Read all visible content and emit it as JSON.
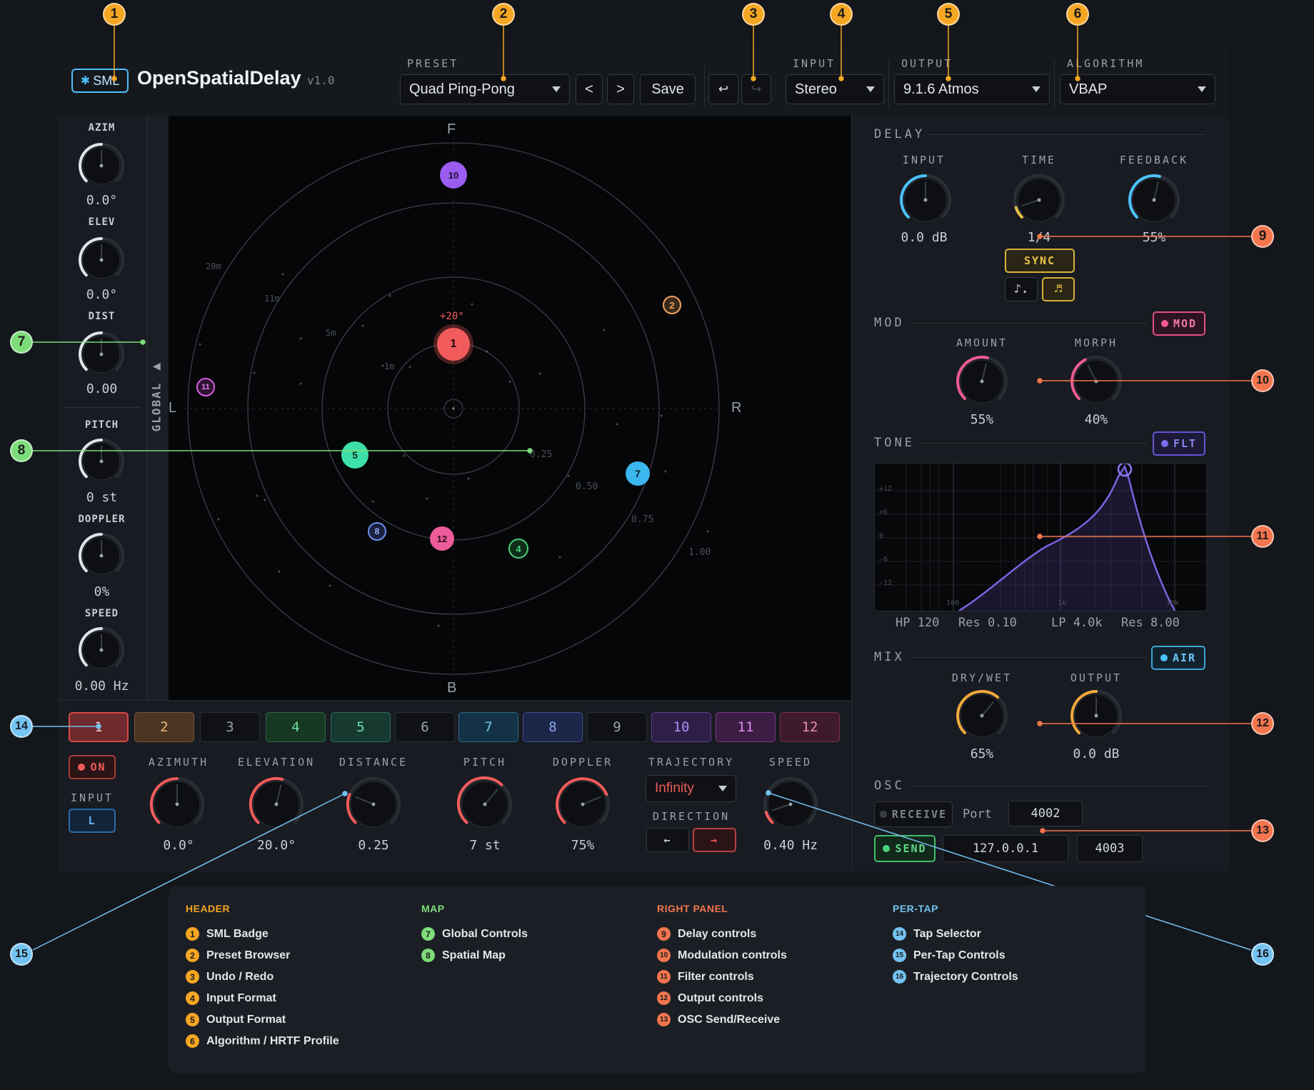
{
  "colors": {
    "orange_callout": "#f5a623",
    "green_callout": "#7ddc7a",
    "red_callout": "#f2754e",
    "blue_callout": "#74c3f2",
    "accent_cyan": "#4cc3ff"
  },
  "header": {
    "badge": "SML",
    "app_name": "OpenSpatialDelay",
    "version": "v1.0",
    "preset_label": "PRESET",
    "preset_value": "Quad Ping-Pong",
    "prev": "<",
    "next": ">",
    "save": "Save",
    "undo": "↩",
    "redo": "↪",
    "input_label": "INPUT",
    "input_value": "Stereo",
    "output_label": "OUTPUT",
    "output_value": "9.1.6 Atmos",
    "algorithm_label": "ALGORITHM",
    "algorithm_value": "VBAP"
  },
  "global": {
    "side_label": "GLOBAL",
    "knobs": [
      {
        "label": "AZIM",
        "value": "0.0°",
        "level": 0.5
      },
      {
        "label": "ELEV",
        "value": "0.0°",
        "level": 0.5
      },
      {
        "label": "DIST",
        "value": "0.00",
        "level": 0.5
      },
      {
        "label": "PITCH",
        "value": "0 st",
        "level": 0.5
      },
      {
        "label": "DOPPLER",
        "value": "0%",
        "level": 0.5
      },
      {
        "label": "SPEED",
        "value": "0.00 Hz",
        "level": 0.5
      }
    ]
  },
  "map": {
    "front": "F",
    "back": "B",
    "left": "L",
    "right": "R",
    "ring_labels": [
      "20m",
      "11m",
      "5m",
      "1m"
    ],
    "value_labels": [
      "0.25",
      "0.50",
      "0.75",
      "1.00"
    ],
    "selected_elevation": "+20°",
    "taps": [
      "1",
      "2",
      "4",
      "5",
      "7",
      "8",
      "10",
      "11",
      "12"
    ]
  },
  "delay": {
    "title": "DELAY",
    "knobs": [
      {
        "label": "INPUT",
        "value": "0.0 dB",
        "level": 0.5
      },
      {
        "label": "TIME",
        "value": "1/4",
        "level": 0.1
      },
      {
        "label": "FEEDBACK",
        "value": "55%",
        "level": 0.55
      }
    ],
    "sync": "SYNC",
    "note_a": "♪.",
    "note_b": "♬"
  },
  "mod": {
    "title": "MOD",
    "toggle": "MOD",
    "knobs": [
      {
        "label": "AMOUNT",
        "value": "55%",
        "level": 0.55
      },
      {
        "label": "MORPH",
        "value": "40%",
        "level": 0.4
      }
    ]
  },
  "tone": {
    "title": "TONE",
    "toggle": "FLT",
    "db_ticks": [
      "+12",
      "+6",
      "0",
      "-6",
      "-12"
    ],
    "freq_ticks": [
      "100",
      "1k",
      "10k"
    ],
    "hp": "HP 120",
    "hp_res": "Res 0.10",
    "lp": "LP 4.0k",
    "lp_res": "Res 8.00"
  },
  "mix": {
    "title": "MIX",
    "toggle": "AIR",
    "knobs": [
      {
        "label": "DRY/WET",
        "value": "65%",
        "level": 0.65
      },
      {
        "label": "OUTPUT",
        "value": "0.0 dB",
        "level": 0.5
      }
    ]
  },
  "osc": {
    "title": "OSC",
    "receive": "RECEIVE",
    "port_label": "Port",
    "receive_port": "4002",
    "send": "SEND",
    "send_ip": "127.0.0.1",
    "send_port": "4003"
  },
  "pertap": {
    "tabs": [
      "1",
      "2",
      "3",
      "4",
      "5",
      "6",
      "7",
      "8",
      "9",
      "10",
      "11",
      "12"
    ],
    "on": "ON",
    "input_label": "INPUT",
    "input_value": "L",
    "knobs": [
      {
        "label": "AZIMUTH",
        "value": "0.0°",
        "level": 0.5
      },
      {
        "label": "ELEVATION",
        "value": "20.0°",
        "level": 0.55
      },
      {
        "label": "DISTANCE",
        "value": "0.25",
        "level": 0.25
      },
      {
        "label": "PITCH",
        "value": "7 st",
        "level": 0.65
      },
      {
        "label": "DOPPLER",
        "value": "75%",
        "level": 0.75
      },
      {
        "label": "SPEED",
        "value": "0.40 Hz",
        "level": 0.1
      }
    ],
    "trajectory_label": "TRAJECTORY",
    "trajectory_value": "Infinity",
    "direction_label": "DIRECTION",
    "dir_left": "←",
    "dir_right": "→"
  },
  "callouts": [
    "1",
    "2",
    "3",
    "4",
    "5",
    "6",
    "7",
    "8",
    "9",
    "10",
    "11",
    "12",
    "13",
    "14",
    "15",
    "16"
  ],
  "legend": {
    "header": {
      "title": "HEADER",
      "items": [
        "SML Badge",
        "Preset Browser",
        "Undo / Redo",
        "Input Format",
        "Output Format",
        "Algorithm / HRTF Profile"
      ]
    },
    "map": {
      "title": "MAP",
      "items": [
        "Global Controls",
        "Spatial Map"
      ]
    },
    "right": {
      "title": "RIGHT PANEL",
      "items": [
        "Delay controls",
        "Modulation controls",
        "Filter controls",
        "Output controls",
        "OSC Send/Receive"
      ]
    },
    "pertap": {
      "title": "PER-TAP",
      "items": [
        "Tap Selector",
        "Per-Tap Controls",
        "Trajectory Controls"
      ]
    }
  }
}
